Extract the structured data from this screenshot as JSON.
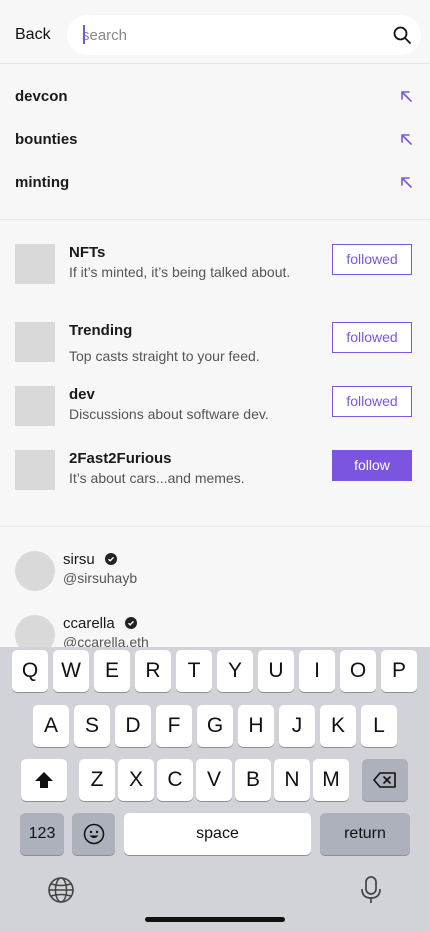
{
  "header": {
    "back_label": "Back",
    "search_placeholder": "search"
  },
  "suggestions": [
    {
      "label": "devcon"
    },
    {
      "label": "bounties"
    },
    {
      "label": "minting"
    }
  ],
  "channels": [
    {
      "name": "NFTs",
      "description": "If it’s minted, it’s being talked about.",
      "button": "followed",
      "followed": true
    },
    {
      "name": "Trending",
      "description": "Top casts straight to your feed.",
      "button": "followed",
      "followed": true
    },
    {
      "name": "dev",
      "description": "Discussions about software dev.",
      "button": "followed",
      "followed": true
    },
    {
      "name": "2Fast2Furious",
      "description": "It’s about cars...and memes.",
      "button": "follow",
      "followed": false
    }
  ],
  "users": [
    {
      "name": "sirsu",
      "handle": "@sirsuhayb",
      "verified": true
    },
    {
      "name": "ccarella",
      "handle": "@ccarella.eth",
      "verified": true
    }
  ],
  "keyboard": {
    "row1": [
      "Q",
      "W",
      "E",
      "R",
      "T",
      "Y",
      "U",
      "I",
      "O",
      "P"
    ],
    "row2": [
      "A",
      "S",
      "D",
      "F",
      "G",
      "H",
      "J",
      "K",
      "L"
    ],
    "row3": [
      "Z",
      "X",
      "C",
      "V",
      "B",
      "N",
      "M"
    ],
    "numbers_label": "123",
    "space_label": "space",
    "return_label": "return"
  },
  "colors": {
    "accent": "#7b55e0",
    "background": "#f7f7f7",
    "keyboard": "#d1d3d9"
  }
}
